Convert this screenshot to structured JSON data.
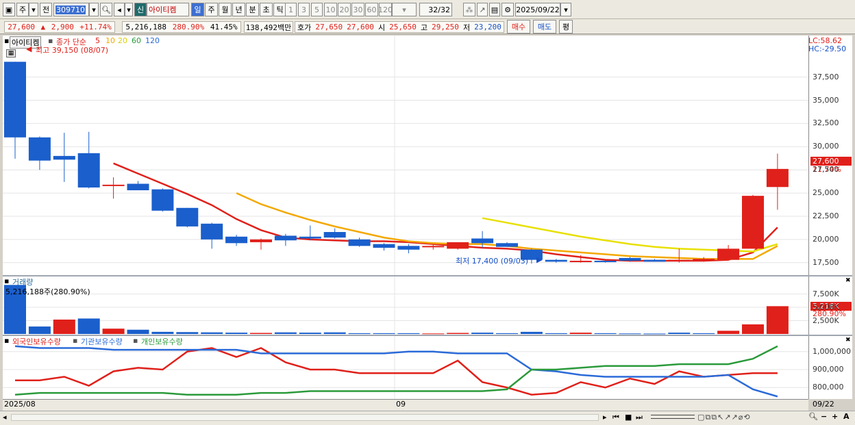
{
  "toolbar": {
    "period_label": "주",
    "prev_label": "전",
    "stock_code": "309710",
    "stock_badge": "신",
    "stock_name": "아이티켐",
    "tabs": [
      "일",
      "주",
      "월",
      "년",
      "분",
      "초",
      "틱"
    ],
    "intervals": [
      "1",
      "3",
      "5",
      "10",
      "20",
      "30",
      "60",
      "120"
    ],
    "page_counter": "32",
    "page_total": "/32",
    "date": "2025/09/22"
  },
  "quote": {
    "price": "27,600",
    "change": "2,900",
    "change_pct": "+11.74%",
    "volume": "5,216,188",
    "volume_pct": "280.90%",
    "turnover": "41.45%",
    "amount": "138,492백만",
    "ask_label": "호가",
    "ask": "27,650",
    "bid": "27,600",
    "open_label": "시",
    "open": "25,650",
    "high_label": "고",
    "high": "29,250",
    "low_label": "저",
    "low": "23,200",
    "buy_label": "매수",
    "sell_label": "매도",
    "eval_label": "평"
  },
  "price_panel": {
    "name_tag": "아이티켐",
    "ma_title": "종가 단순",
    "ma_periods": [
      "5",
      "10",
      "20",
      "60",
      "120"
    ],
    "ma_colors": [
      "#e0201a",
      "#f3a800",
      "#e8e000",
      "#2a9a3a",
      "#2a6ad8"
    ],
    "max_label": "최고 39,150 (08/07)",
    "min_label": "최저 17,400 (09/03)",
    "lc_label": "LC:58.62",
    "hc_label": "HC:-29.50",
    "current_tag": "27,600",
    "current_pct": "11.74%"
  },
  "volume_panel": {
    "title": "거래량",
    "summary": "5,216,188주(280.90%)",
    "current_tag": "5,216K",
    "current_pct": "280.90%"
  },
  "holding_panel": {
    "legend": [
      "외국인보유수량",
      "기관보유수량",
      "개인보유수량"
    ]
  },
  "x_axis": {
    "labels": [
      "2025/08",
      "09",
      "09/22"
    ]
  },
  "chart_data": {
    "type": "candlestick",
    "ylim": [
      16300,
      40500
    ],
    "yticks": [
      17500,
      20000,
      22500,
      25000,
      27500,
      30000,
      32500,
      35000,
      37500
    ],
    "ytick_labels": [
      "17,500",
      "20,000",
      "22,500",
      "25,000",
      "27,500",
      "30,000",
      "32,500",
      "35,000",
      "37,500"
    ],
    "candles": [
      {
        "o": 39150,
        "h": 39150,
        "l": 28700,
        "c": 31000
      },
      {
        "o": 31000,
        "h": 31100,
        "l": 27500,
        "c": 28500
      },
      {
        "o": 29000,
        "h": 31500,
        "l": 26200,
        "c": 28600
      },
      {
        "o": 29300,
        "h": 31600,
        "l": 25500,
        "c": 25600
      },
      {
        "o": 25800,
        "h": 26700,
        "l": 24400,
        "c": 25900
      },
      {
        "o": 26000,
        "h": 26300,
        "l": 25300,
        "c": 25300
      },
      {
        "o": 25400,
        "h": 25500,
        "l": 23000,
        "c": 23100
      },
      {
        "o": 23400,
        "h": 23400,
        "l": 21300,
        "c": 21400
      },
      {
        "o": 21700,
        "h": 21800,
        "l": 19000,
        "c": 20000
      },
      {
        "o": 20300,
        "h": 20500,
        "l": 19300,
        "c": 19600
      },
      {
        "o": 19700,
        "h": 20100,
        "l": 18900,
        "c": 20000
      },
      {
        "o": 20400,
        "h": 20600,
        "l": 19300,
        "c": 19900
      },
      {
        "o": 20300,
        "h": 21500,
        "l": 19900,
        "c": 20100
      },
      {
        "o": 20800,
        "h": 21200,
        "l": 20100,
        "c": 20200
      },
      {
        "o": 20000,
        "h": 20200,
        "l": 19200,
        "c": 19300
      },
      {
        "o": 19500,
        "h": 19600,
        "l": 18800,
        "c": 19100
      },
      {
        "o": 19300,
        "h": 19500,
        "l": 18500,
        "c": 18900
      },
      {
        "o": 19200,
        "h": 19400,
        "l": 18900,
        "c": 19300
      },
      {
        "o": 19000,
        "h": 19500,
        "l": 18900,
        "c": 19700
      },
      {
        "o": 20100,
        "h": 20900,
        "l": 19100,
        "c": 19600
      },
      {
        "o": 19600,
        "h": 19700,
        "l": 19200,
        "c": 19200
      },
      {
        "o": 18900,
        "h": 19000,
        "l": 17400,
        "c": 17800
      },
      {
        "o": 17800,
        "h": 17900,
        "l": 17500,
        "c": 17600
      },
      {
        "o": 17600,
        "h": 18300,
        "l": 17500,
        "c": 17700
      },
      {
        "o": 17700,
        "h": 17800,
        "l": 17500,
        "c": 17600
      },
      {
        "o": 18000,
        "h": 18100,
        "l": 17600,
        "c": 17700
      },
      {
        "o": 17800,
        "h": 17900,
        "l": 17600,
        "c": 17600
      },
      {
        "o": 17700,
        "h": 19000,
        "l": 17500,
        "c": 17800
      },
      {
        "o": 17700,
        "h": 18100,
        "l": 17600,
        "c": 17900
      },
      {
        "o": 17800,
        "h": 19400,
        "l": 17800,
        "c": 19000
      },
      {
        "o": 19000,
        "h": 24800,
        "l": 19000,
        "c": 24700
      },
      {
        "o": 25650,
        "h": 29250,
        "l": 23200,
        "c": 27600
      }
    ],
    "ma": [
      {
        "period": "5",
        "color": "#e0201a",
        "start": 4,
        "values": [
          28200,
          27100,
          26000,
          24900,
          23700,
          22200,
          21000,
          20200,
          20000,
          19900,
          19800,
          19800,
          19700,
          19500,
          19300,
          19100,
          19000,
          18800,
          18400,
          18100,
          17800,
          17700,
          17700,
          17700,
          17700,
          17800,
          18600,
          21300
        ]
      },
      {
        "period": "10",
        "color": "#f3a800",
        "start": 9,
        "values": [
          25000,
          23800,
          22900,
          22100,
          21400,
          20800,
          20200,
          19800,
          19600,
          19500,
          19500,
          19300,
          19000,
          18800,
          18600,
          18400,
          18200,
          18100,
          18000,
          17900,
          17900,
          17900,
          19300
        ]
      },
      {
        "period": "20",
        "color": "#e8e000",
        "start": 19,
        "values": [
          22300,
          21800,
          21300,
          20800,
          20300,
          19900,
          19500,
          19200,
          19000,
          18900,
          18800,
          18700,
          19500
        ]
      },
      {
        "period": "60",
        "color": "#2a9a3a",
        "start": 32,
        "values": []
      },
      {
        "period": "120",
        "color": "#2a6ad8",
        "start": 32,
        "values": []
      }
    ],
    "volume": {
      "ylim": [
        0,
        9500000
      ],
      "yticks": [
        2500000,
        5000000,
        7500000
      ],
      "ytick_labels": [
        "2,500K",
        "5,000K",
        "7,500K"
      ],
      "values": [
        9200000,
        1400000,
        2700000,
        2900000,
        1000000,
        800000,
        400000,
        350000,
        300000,
        250000,
        200000,
        300000,
        250000,
        300000,
        150000,
        150000,
        150000,
        100000,
        200000,
        250000,
        150000,
        400000,
        150000,
        250000,
        150000,
        100000,
        80000,
        250000,
        150000,
        600000,
        1800000,
        5216188
      ],
      "up": [
        false,
        false,
        true,
        false,
        true,
        false,
        false,
        false,
        false,
        false,
        true,
        false,
        false,
        false,
        false,
        false,
        false,
        true,
        true,
        false,
        false,
        false,
        false,
        true,
        false,
        false,
        false,
        false,
        false,
        true,
        true,
        true
      ]
    },
    "holdings": {
      "ylim": [
        740000,
        1060000
      ],
      "yticks": [
        800000,
        900000,
        1000000
      ],
      "ytick_labels": [
        "800,000",
        "900,000",
        "1,000,000"
      ],
      "series": [
        {
          "name": "외국인보유수량",
          "color": "#e0201a",
          "values": [
            840000,
            840000,
            860000,
            810000,
            890000,
            910000,
            900000,
            1000000,
            1020000,
            970000,
            1020000,
            940000,
            900000,
            900000,
            880000,
            880000,
            880000,
            880000,
            950000,
            830000,
            800000,
            760000,
            770000,
            830000,
            800000,
            850000,
            820000,
            890000,
            860000,
            870000,
            880000,
            880000
          ]
        },
        {
          "name": "기관보유수량",
          "color": "#2a6ad8",
          "values": [
            1030000,
            1020000,
            1020000,
            1020000,
            1010000,
            1010000,
            1010000,
            1010000,
            1010000,
            1010000,
            990000,
            990000,
            990000,
            990000,
            990000,
            990000,
            1000000,
            1000000,
            990000,
            990000,
            990000,
            900000,
            890000,
            870000,
            860000,
            860000,
            860000,
            860000,
            860000,
            870000,
            790000,
            750000
          ]
        },
        {
          "name": "개인보유수량",
          "color": "#2a9a3a",
          "values": [
            760000,
            770000,
            770000,
            770000,
            770000,
            770000,
            770000,
            760000,
            760000,
            760000,
            770000,
            770000,
            780000,
            780000,
            780000,
            780000,
            780000,
            780000,
            780000,
            780000,
            790000,
            900000,
            900000,
            910000,
            920000,
            920000,
            920000,
            930000,
            930000,
            930000,
            960000,
            1030000
          ]
        }
      ]
    }
  }
}
